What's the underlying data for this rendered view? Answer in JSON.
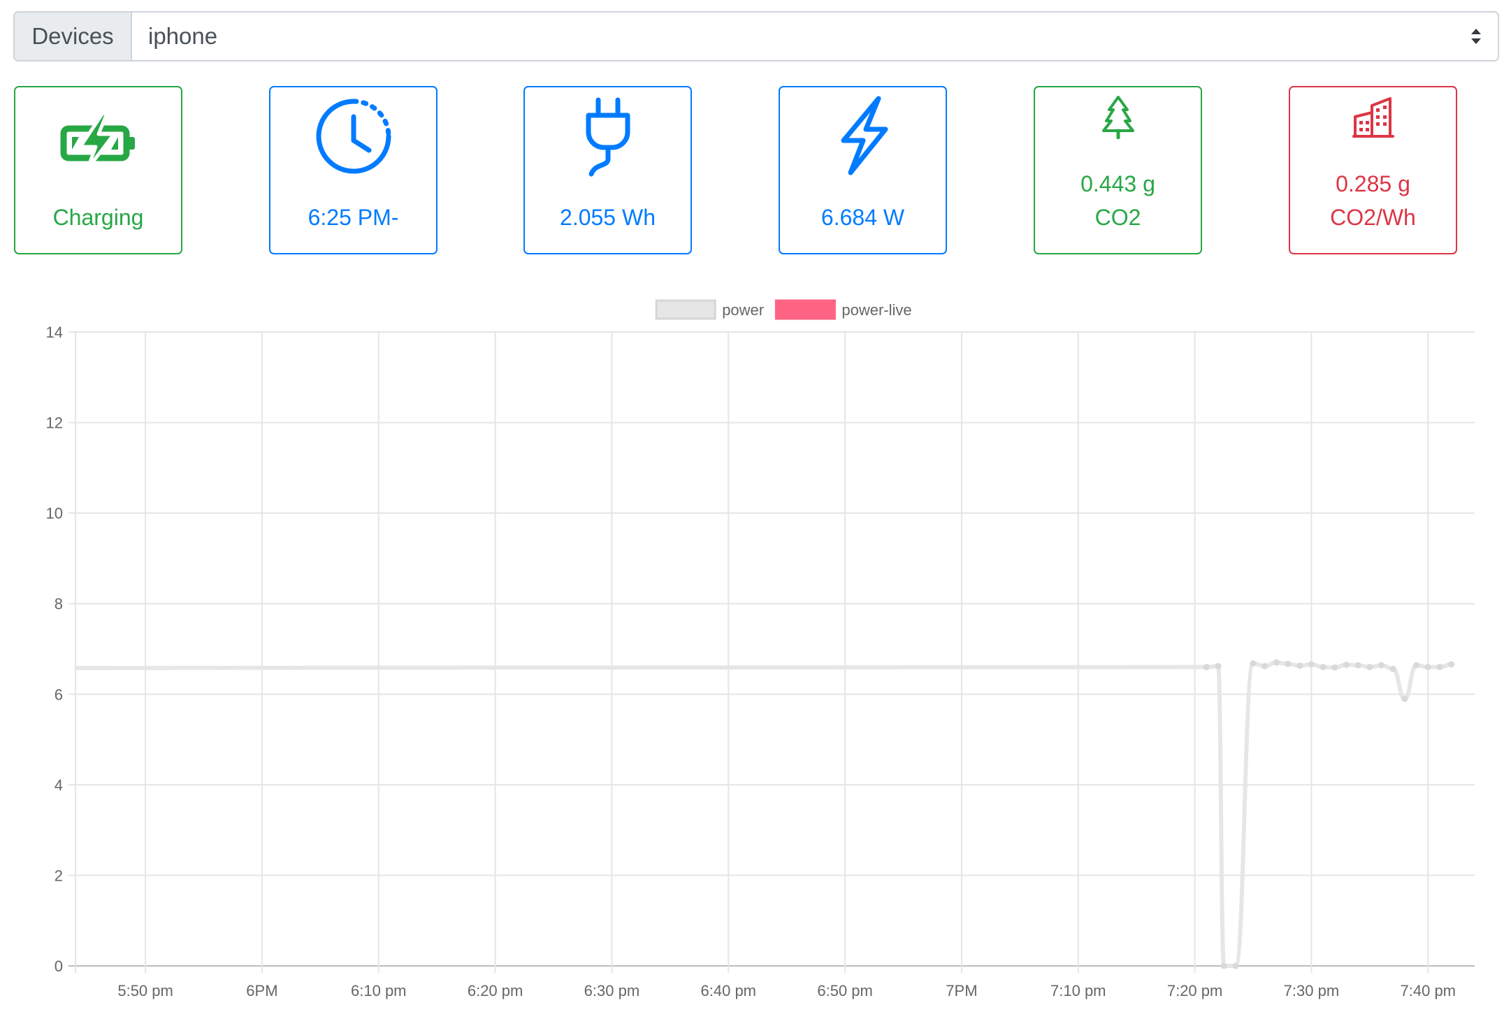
{
  "device_selector": {
    "label": "Devices",
    "selected": "iphone"
  },
  "cards": [
    {
      "text": "Charging",
      "icon": "battery-charging-icon",
      "color": "#28a745"
    },
    {
      "text": "6:25 PM-",
      "icon": "clock-history-icon",
      "color": "#007bff"
    },
    {
      "text": "2.055 Wh",
      "icon": "plug-icon",
      "color": "#007bff"
    },
    {
      "text": "6.684 W",
      "icon": "lightning-icon",
      "color": "#007bff"
    },
    {
      "text": "0.443 g",
      "text2": "CO2",
      "icon": "tree-icon",
      "color": "#28a745"
    },
    {
      "text": "0.285 g",
      "text2": "CO2/Wh",
      "icon": "buildings-icon",
      "color": "#dc3545"
    }
  ],
  "chart_data": {
    "type": "line",
    "legend": [
      {
        "name": "power",
        "color": "#e6e6e6"
      },
      {
        "name": "power-live",
        "color": "#ff6384"
      }
    ],
    "legend_position": "top",
    "grid": true,
    "ylim": [
      0,
      14
    ],
    "yticks": [
      0,
      2,
      4,
      6,
      8,
      10,
      12,
      14
    ],
    "xlim": [
      "17:44",
      "19:44"
    ],
    "xticks": [
      {
        "t": "17:50",
        "label": "5:50 pm"
      },
      {
        "t": "18:00",
        "label": "6PM"
      },
      {
        "t": "18:10",
        "label": "6:10 pm"
      },
      {
        "t": "18:20",
        "label": "6:20 pm"
      },
      {
        "t": "18:30",
        "label": "6:30 pm"
      },
      {
        "t": "18:40",
        "label": "6:40 pm"
      },
      {
        "t": "18:50",
        "label": "6:50 pm"
      },
      {
        "t": "19:00",
        "label": "7PM"
      },
      {
        "t": "19:10",
        "label": "7:10 pm"
      },
      {
        "t": "19:20",
        "label": "7:20 pm"
      },
      {
        "t": "19:30",
        "label": "7:30 pm"
      },
      {
        "t": "19:40",
        "label": "7:40 pm"
      }
    ],
    "series": [
      {
        "name": "power",
        "color": "#e6e6e6",
        "points": [
          {
            "t": "17:44",
            "y": 6.58
          },
          {
            "t": "19:21",
            "y": 6.6
          },
          {
            "t": "19:22",
            "y": 6.62
          },
          {
            "t": "19:22:30",
            "y": 0
          },
          {
            "t": "19:23:30",
            "y": 0
          },
          {
            "t": "19:25",
            "y": 6.68
          },
          {
            "t": "19:26",
            "y": 6.62
          },
          {
            "t": "19:27",
            "y": 6.7
          },
          {
            "t": "19:28",
            "y": 6.67
          },
          {
            "t": "19:29",
            "y": 6.63
          },
          {
            "t": "19:30",
            "y": 6.66
          },
          {
            "t": "19:31",
            "y": 6.6
          },
          {
            "t": "19:32",
            "y": 6.59
          },
          {
            "t": "19:33",
            "y": 6.65
          },
          {
            "t": "19:34",
            "y": 6.64
          },
          {
            "t": "19:35",
            "y": 6.6
          },
          {
            "t": "19:36",
            "y": 6.64
          },
          {
            "t": "19:37",
            "y": 6.56
          },
          {
            "t": "19:38",
            "y": 5.9
          },
          {
            "t": "19:39",
            "y": 6.64
          },
          {
            "t": "19:40",
            "y": 6.6
          },
          {
            "t": "19:41",
            "y": 6.6
          },
          {
            "t": "19:42",
            "y": 6.66
          }
        ]
      },
      {
        "name": "power-live",
        "color": "#ff6384",
        "points": []
      }
    ]
  }
}
